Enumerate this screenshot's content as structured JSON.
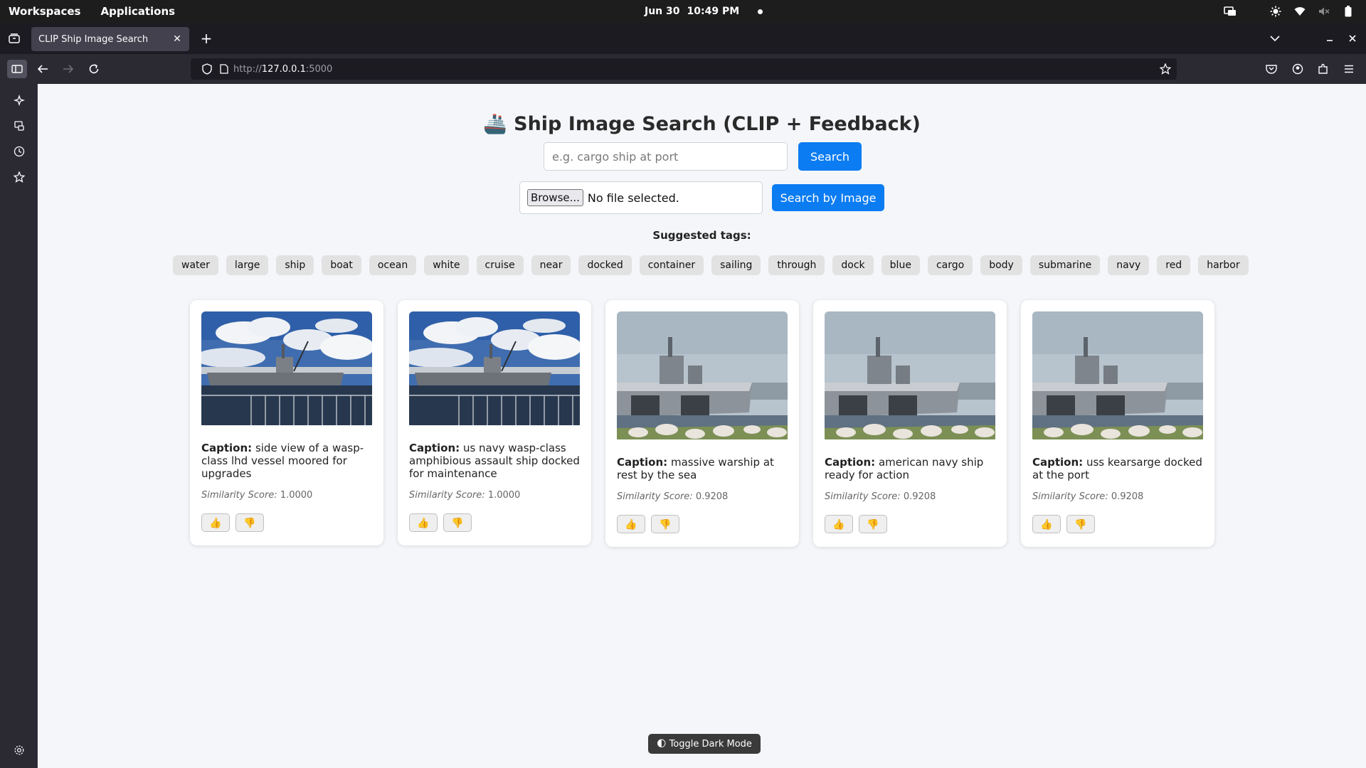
{
  "desktop": {
    "workspaces": "Workspaces",
    "applications": "Applications",
    "date": "Jun 30",
    "time": "10:49 PM"
  },
  "browser": {
    "tab_title": "CLIP Ship Image Search",
    "url_scheme": "http://",
    "url_host": "127.0.0.1",
    "url_port": ":5000"
  },
  "page": {
    "title_icon": "🚢",
    "title": "Ship Image Search (CLIP + Feedback)",
    "search_placeholder": "e.g. cargo ship at port",
    "search_button": "Search",
    "browse_button": "Browse...",
    "file_status": "No file selected.",
    "image_search_button": "Search by Image",
    "tags_label": "Suggested tags:",
    "tags": [
      "water",
      "large",
      "ship",
      "boat",
      "ocean",
      "white",
      "cruise",
      "near",
      "docked",
      "container",
      "sailing",
      "through",
      "dock",
      "blue",
      "cargo",
      "body",
      "submarine",
      "navy",
      "red",
      "harbor"
    ],
    "caption_label": "Caption:",
    "score_label": "Similarity Score:",
    "like_icon": "👍",
    "dislike_icon": "👎",
    "results": [
      {
        "caption": "side view of a wasp-class lhd vessel moored for upgrades",
        "score": "1.0000",
        "image": "ship-a"
      },
      {
        "caption": "us navy wasp-class amphibious assault ship docked for maintenance",
        "score": "1.0000",
        "image": "ship-a"
      },
      {
        "caption": "massive warship at rest by the sea",
        "score": "0.9208",
        "image": "ship-b"
      },
      {
        "caption": "american navy ship ready for action",
        "score": "0.9208",
        "image": "ship-b"
      },
      {
        "caption": "uss kearsarge docked at the port",
        "score": "0.9208",
        "image": "ship-b"
      }
    ],
    "toggle_icon": "🌓",
    "toggle_label": "Toggle Dark Mode"
  }
}
